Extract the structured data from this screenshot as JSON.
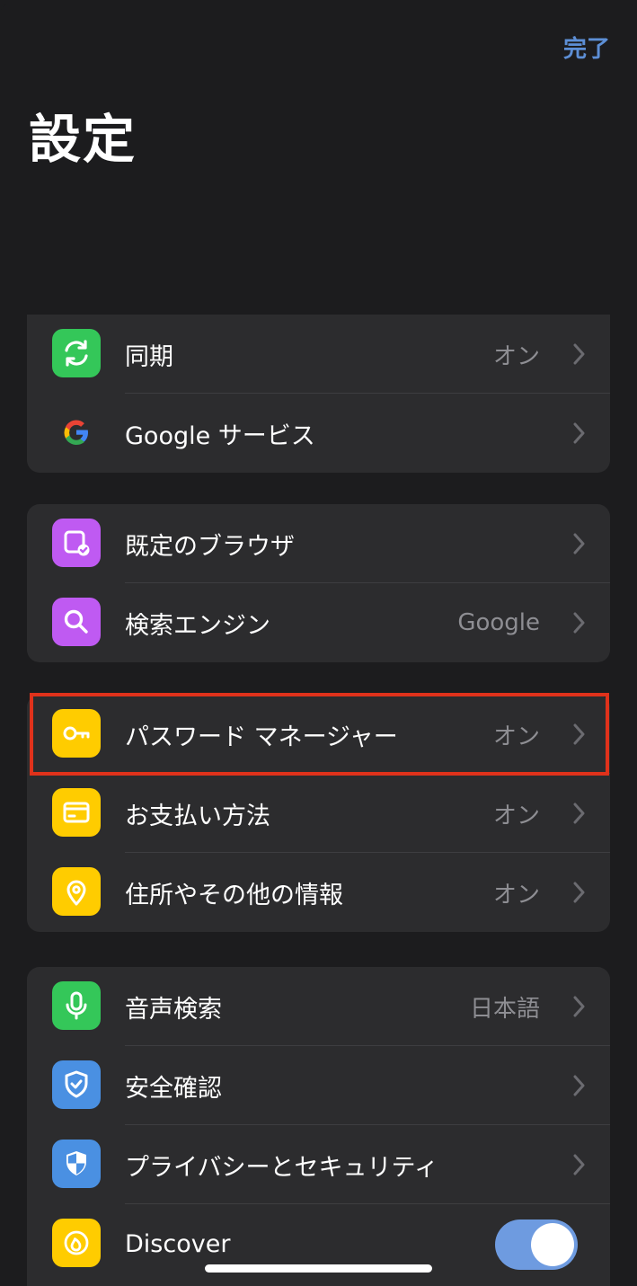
{
  "header": {
    "done_label": "完了",
    "title": "設定"
  },
  "groups": [
    {
      "rows": [
        {
          "label": "同期",
          "value": "オン",
          "icon": "sync-icon",
          "icon_bg": "#34c759"
        },
        {
          "label": "Google サービス",
          "value": "",
          "icon": "google-g-icon",
          "icon_bg": ""
        }
      ]
    },
    {
      "rows": [
        {
          "label": "既定のブラウザ",
          "value": "",
          "icon": "default-browser-icon",
          "icon_bg": "#bf5af2"
        },
        {
          "label": "検索エンジン",
          "value": "Google",
          "icon": "search-icon",
          "icon_bg": "#bf5af2"
        }
      ]
    },
    {
      "rows": [
        {
          "label": "パスワード マネージャー",
          "value": "オン",
          "icon": "key-icon",
          "icon_bg": "#ffcc00"
        },
        {
          "label": "お支払い方法",
          "value": "オン",
          "icon": "credit-card-icon",
          "icon_bg": "#ffcc00"
        },
        {
          "label": "住所やその他の情報",
          "value": "オン",
          "icon": "location-pin-icon",
          "icon_bg": "#ffcc00"
        }
      ]
    },
    {
      "rows": [
        {
          "label": "音声検索",
          "value": "日本語",
          "icon": "microphone-icon",
          "icon_bg": "#34c759"
        },
        {
          "label": "安全確認",
          "value": "",
          "icon": "shield-check-icon",
          "icon_bg": "#4a90e2"
        },
        {
          "label": "プライバシーとセキュリティ",
          "value": "",
          "icon": "shield-icon",
          "icon_bg": "#4a90e2"
        },
        {
          "label": "Discover",
          "value": "",
          "icon": "discover-flame-icon",
          "icon_bg": "#ffcc00",
          "toggle": "on"
        }
      ]
    }
  ],
  "colors": {
    "accent": "#5d8fd6",
    "highlight": "#e0321b",
    "toggle_on": "#6e9be0"
  }
}
